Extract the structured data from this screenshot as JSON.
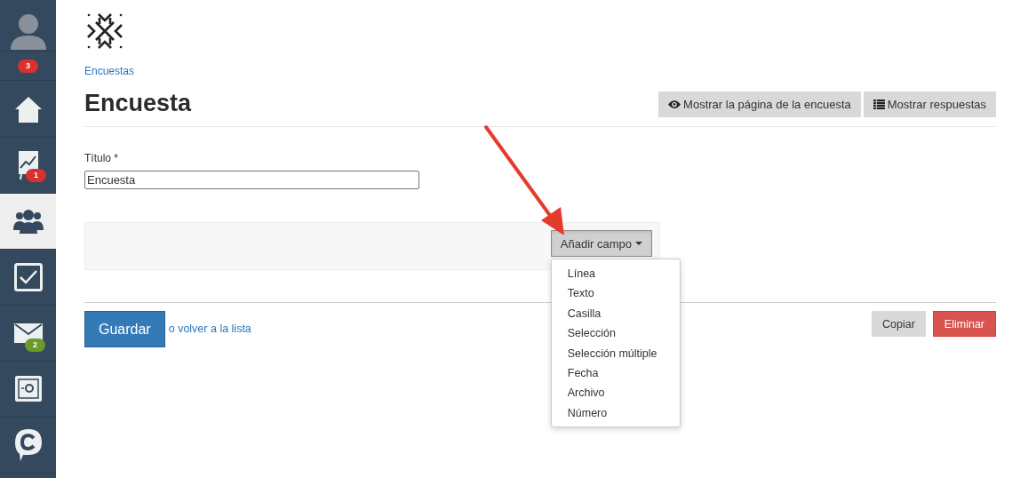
{
  "sidebar": {
    "items": [
      {
        "kind": "avatar",
        "selected": false
      },
      {
        "kind": "counter",
        "selected": false,
        "badge": {
          "text": "3",
          "color": "#d9322e"
        }
      },
      {
        "kind": "home",
        "selected": false
      },
      {
        "kind": "chart",
        "selected": false,
        "badge": {
          "text": "1",
          "color": "#d9322e"
        }
      },
      {
        "kind": "people",
        "selected": true
      },
      {
        "kind": "tasks",
        "selected": false
      },
      {
        "kind": "mail",
        "selected": false,
        "badge": {
          "text": "2",
          "color": "#6b9a2a"
        }
      },
      {
        "kind": "safe",
        "selected": false
      },
      {
        "kind": "chat",
        "selected": false
      }
    ]
  },
  "breadcrumb": "Encuestas",
  "title": "Encuesta",
  "header_buttons": [
    {
      "kind": "eye",
      "label": "Mostrar la página de la encuesta"
    },
    {
      "kind": "list",
      "label": "Mostrar respuestas"
    }
  ],
  "form": {
    "label": "Título *",
    "value": "Encuesta"
  },
  "add_field": {
    "label": "Añadir campo",
    "expanded": true,
    "options": [
      "Línea",
      "Texto",
      "Casilla",
      "Selección",
      "Selección múltiple",
      "Fecha",
      "Archivo",
      "Número"
    ]
  },
  "footer": {
    "save": "Guardar",
    "or_text": "o ",
    "back_link": "volver a la lista",
    "copy": "Copiar",
    "delete": "Eliminar"
  }
}
